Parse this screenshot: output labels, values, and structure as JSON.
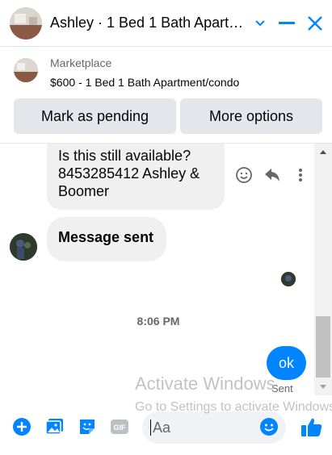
{
  "header": {
    "title": "Ashley · 1 Bed 1 Bath Apart…"
  },
  "marketplace": {
    "source": "Marketplace",
    "item": "$600 - 1 Bed 1 Bath Apartment/condo",
    "mark_pending_label": "Mark as pending",
    "more_options_label": "More options"
  },
  "messages": {
    "incoming_1": "Is this still available? 8453285412 Ashley & Boomer",
    "incoming_2": "Message sent",
    "timestamp": "8:06 PM",
    "outgoing_1": "ok",
    "status": "Sent"
  },
  "watermark": {
    "line1": "Activate Windows",
    "line2": "Go to Settings to activate Windows."
  },
  "composer": {
    "placeholder": "Aa"
  },
  "colors": {
    "accent": "#0084ff",
    "bubble_bg": "#f0f0f0",
    "button_bg": "#e4e6eb"
  }
}
